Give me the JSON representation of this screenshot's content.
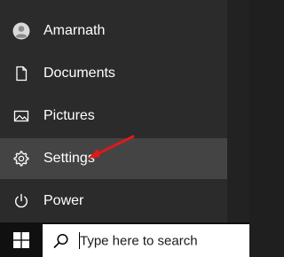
{
  "start_menu": {
    "items": [
      {
        "label": "Amarnath",
        "icon": "user-avatar-icon",
        "active": false
      },
      {
        "label": "Documents",
        "icon": "document-icon",
        "active": false
      },
      {
        "label": "Pictures",
        "icon": "pictures-icon",
        "active": false
      },
      {
        "label": "Settings",
        "icon": "gear-icon",
        "active": true
      },
      {
        "label": "Power",
        "icon": "power-icon",
        "active": false
      }
    ]
  },
  "taskbar": {
    "start_icon": "windows-logo-icon",
    "search": {
      "placeholder": "Type here to search",
      "icon": "search-icon"
    }
  },
  "annotation": {
    "arrow_color": "#e0191b",
    "target": "Settings"
  },
  "colors": {
    "panel_bg": "#2b2b2b",
    "active_item_bg": "#444444",
    "taskbar_bg": "#101010",
    "text": "#ffffff"
  }
}
